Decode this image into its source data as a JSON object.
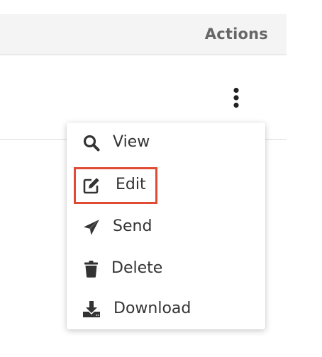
{
  "table": {
    "header": {
      "actions_label": "Actions"
    }
  },
  "row": {
    "menu_button_icon": "more-vertical-icon"
  },
  "menu": {
    "items": [
      {
        "label": "View",
        "icon": "search-icon"
      },
      {
        "label": "Edit",
        "icon": "edit-icon",
        "highlighted": true
      },
      {
        "label": "Send",
        "icon": "send-icon"
      },
      {
        "label": "Delete",
        "icon": "trash-icon"
      },
      {
        "label": "Download",
        "icon": "download-icon"
      }
    ]
  },
  "colors": {
    "highlight": "#e04b35",
    "icon": "#333333",
    "header_bg": "#f4f4f4"
  }
}
